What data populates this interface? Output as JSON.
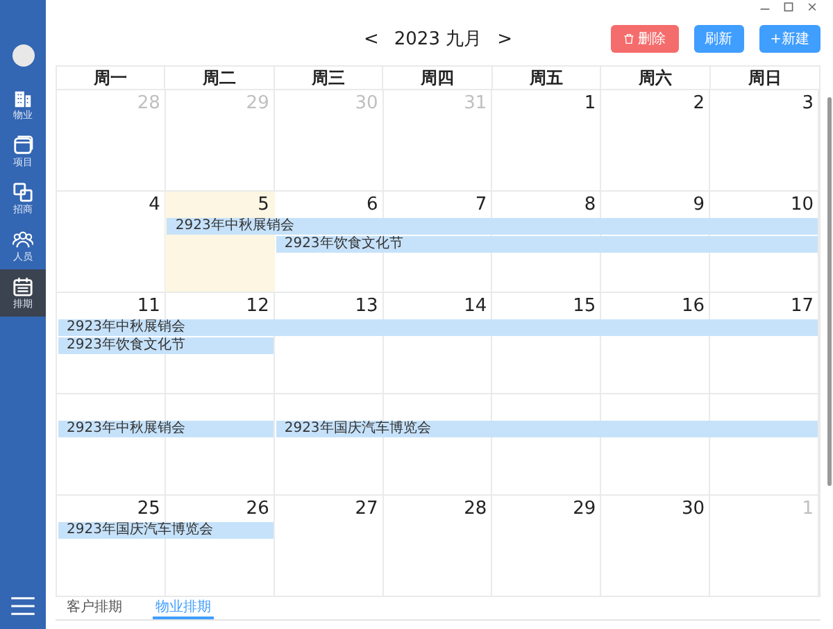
{
  "sidebar": {
    "items": [
      {
        "label": "物业",
        "kind": "building",
        "selected": false
      },
      {
        "label": "项目",
        "kind": "window",
        "selected": false
      },
      {
        "label": "招商",
        "kind": "squares",
        "selected": false
      },
      {
        "label": "人员",
        "kind": "people",
        "selected": false
      },
      {
        "label": "排期",
        "kind": "calendar",
        "selected": true
      }
    ]
  },
  "header": {
    "prev": "<",
    "title": "2023 九月",
    "next": ">"
  },
  "buttons": [
    {
      "label": "删除",
      "kind": "danger"
    },
    {
      "label": "刷新",
      "kind": "primary"
    },
    {
      "label": "+新建",
      "kind": "primary"
    }
  ],
  "calendar": {
    "weekdays": [
      "周一",
      "周二",
      "周三",
      "周四",
      "周五",
      "周六",
      "周日"
    ],
    "weeks": [
      {
        "days": [
          {
            "number": "28",
            "other_month": true,
            "today": false
          },
          {
            "number": "29",
            "other_month": true,
            "today": false
          },
          {
            "number": "30",
            "other_month": true,
            "today": false
          },
          {
            "number": "31",
            "other_month": true,
            "today": false
          },
          {
            "number": "1",
            "other_month": false,
            "today": false
          },
          {
            "number": "2",
            "other_month": false,
            "today": false
          },
          {
            "number": "3",
            "other_month": false,
            "today": false
          }
        ]
      },
      {
        "days": [
          {
            "number": "4",
            "other_month": false,
            "today": false
          },
          {
            "number": "5",
            "other_month": false,
            "today": true
          },
          {
            "number": "6",
            "other_month": false,
            "today": false
          },
          {
            "number": "7",
            "other_month": false,
            "today": false
          },
          {
            "number": "8",
            "other_month": false,
            "today": false
          },
          {
            "number": "9",
            "other_month": false,
            "today": false
          },
          {
            "number": "10",
            "other_month": false,
            "today": false
          }
        ],
        "lanes": [
          [
            {
              "kind": "empty"
            },
            {
              "kind": "start",
              "title": "2923年中秋展销会"
            },
            {
              "kind": "continue"
            },
            {
              "kind": "continue"
            },
            {
              "kind": "continue"
            },
            {
              "kind": "continue"
            },
            {
              "kind": "continue"
            }
          ],
          [
            {
              "kind": "empty"
            },
            {
              "kind": "empty"
            },
            {
              "kind": "start",
              "title": "2923年饮食文化节"
            },
            {
              "kind": "continue"
            },
            {
              "kind": "continue"
            },
            {
              "kind": "continue"
            },
            {
              "kind": "continue"
            }
          ]
        ]
      },
      {
        "days": [
          {
            "number": "11",
            "other_month": false,
            "today": false
          },
          {
            "number": "12",
            "other_month": false,
            "today": false
          },
          {
            "number": "13",
            "other_month": false,
            "today": false
          },
          {
            "number": "14",
            "other_month": false,
            "today": false
          },
          {
            "number": "15",
            "other_month": false,
            "today": false
          },
          {
            "number": "16",
            "other_month": false,
            "today": false
          },
          {
            "number": "17",
            "other_month": false,
            "today": false
          }
        ],
        "lanes": [
          [
            {
              "kind": "start",
              "title": "2923年中秋展销会"
            },
            {
              "kind": "continue"
            },
            {
              "kind": "continue"
            },
            {
              "kind": "continue"
            },
            {
              "kind": "continue"
            },
            {
              "kind": "continue"
            },
            {
              "kind": "continue"
            }
          ],
          [
            {
              "kind": "start",
              "title": "2923年饮食文化节"
            },
            {
              "kind": "continue"
            },
            {
              "kind": "empty"
            },
            {
              "kind": "empty"
            },
            {
              "kind": "empty"
            },
            {
              "kind": "empty"
            },
            {
              "kind": "empty"
            }
          ]
        ]
      },
      {
        "lanes": [
          [
            {
              "kind": "start",
              "title": "2923年中秋展销会"
            },
            {
              "kind": "continue"
            },
            {
              "kind": "start",
              "title": "2923年国庆汽车博览会"
            },
            {
              "kind": "continue"
            },
            {
              "kind": "continue"
            },
            {
              "kind": "continue"
            },
            {
              "kind": "continue"
            }
          ]
        ]
      },
      {
        "lanes": [
          [
            {
              "kind": "start",
              "title": "2923年国庆汽车博览会"
            },
            {
              "kind": "continue"
            },
            {
              "kind": "empty"
            },
            {
              "kind": "empty"
            },
            {
              "kind": "empty"
            },
            {
              "kind": "empty"
            },
            {
              "kind": "empty"
            }
          ]
        ],
        "days": [
          {
            "number": "25",
            "other_month": false,
            "today": false
          },
          {
            "number": "26",
            "other_month": false,
            "today": false
          },
          {
            "number": "27",
            "other_month": false,
            "today": false
          },
          {
            "number": "28",
            "other_month": false,
            "today": false
          },
          {
            "number": "29",
            "other_month": false,
            "today": false
          },
          {
            "number": "30",
            "other_month": false,
            "today": false
          },
          {
            "number": "1",
            "other_month": true,
            "today": false
          }
        ]
      }
    ]
  },
  "bottom_tabs": [
    {
      "label": "客户排期",
      "selected": false
    },
    {
      "label": "物业排期",
      "selected": true
    }
  ]
}
